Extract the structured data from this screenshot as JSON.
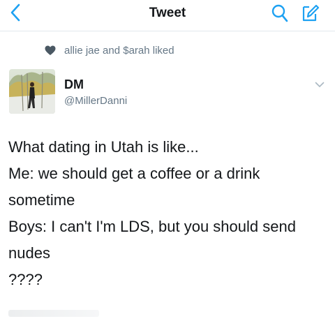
{
  "header": {
    "title": "Tweet"
  },
  "social_context": {
    "text": "allie jae and $arah liked"
  },
  "author": {
    "name": "DM",
    "handle": "@MillerDanni"
  },
  "tweet": {
    "lines": [
      "What dating in Utah is like...",
      "Me: we should get a coffee or a drink sometime",
      "Boys: I can't I'm LDS, but you should send nudes"
    ],
    "tail": "????"
  },
  "colors": {
    "accent": "#1da1f2",
    "secondary_text": "#657786",
    "primary_text": "#14171a"
  },
  "icons": {
    "back": "chevron-left-icon",
    "search": "search-icon",
    "compose": "compose-icon",
    "liked": "heart-icon",
    "menu": "chevron-down-icon"
  }
}
